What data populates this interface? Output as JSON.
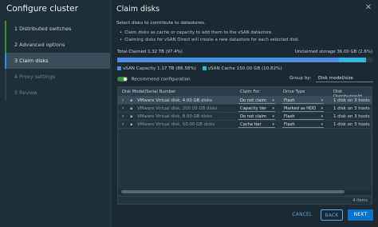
{
  "wizard": {
    "title": "Configure cluster",
    "steps": [
      {
        "label": "1  Distributed switches",
        "state": "done"
      },
      {
        "label": "2  Advanced options",
        "state": "done"
      },
      {
        "label": "3  Claim disks",
        "state": "active"
      },
      {
        "label": "4  Proxy settings",
        "state": "pending"
      },
      {
        "label": "5  Review",
        "state": "pending"
      }
    ]
  },
  "main": {
    "title": "Claim disks",
    "close_icon": "close-icon",
    "description": "Select disks to contribute to datastores.",
    "bullets": [
      "Claim disks as cache or capacity to add them to the vSAN datastore.",
      "Claiming disks for vSAN Direct will create a new datastore for each selected disk."
    ],
    "total_claimed": "Total Claimed 1.32 TB (97.4%)",
    "unclaimed": "Unclaimed storage 36.00 GB (2.6%)",
    "bar": {
      "capacity_fraction": 0.868,
      "cache_fraction": 0.106,
      "capacity_color": "#4b8fdf",
      "cache_color": "#32b9d9"
    },
    "legend": [
      {
        "label": "vSAN Capacity 1.17 TB (86.58%)",
        "color": "#4b8fdf"
      },
      {
        "label": "vSAN Cache 150.00 GB (10.82%)",
        "color": "#32b9d9"
      }
    ],
    "recommend_label": "Recommend configuration",
    "recommend_on": true,
    "groupby_label": "Group by:",
    "groupby_value": "Disk model/size"
  },
  "table": {
    "headers": [
      "Disk Model/Serial Number",
      "Claim For",
      "Drive Type",
      "Disk Distribution/H"
    ],
    "rows": [
      {
        "name": "VMware Virtual disk, 4.00 GB disks",
        "claim": "Do not claim",
        "drive": "Flash",
        "dist": "1 disk on 3 hosts",
        "selected": true,
        "dim": false
      },
      {
        "name": "VMware Virtual disk, 200.00 GB disks",
        "claim": "Capacity tier",
        "drive": "Marked as HDD",
        "dist": "1 disk on 3 hosts",
        "selected": false,
        "dim": true
      },
      {
        "name": "VMware Virtual disk, 8.00 GB disks",
        "claim": "Do not claim",
        "drive": "Flash",
        "dist": "1 disk on 3 hosts",
        "selected": false,
        "dim": true
      },
      {
        "name": "VMware Virtual disk, 50.00 GB disks",
        "claim": "Cache tier",
        "drive": "Flash",
        "dist": "1 disk on 3 hosts",
        "selected": false,
        "dim": true
      }
    ],
    "footer": "4 items"
  },
  "buttons": {
    "cancel": "CANCEL",
    "back": "BACK",
    "next": "NEXT"
  }
}
